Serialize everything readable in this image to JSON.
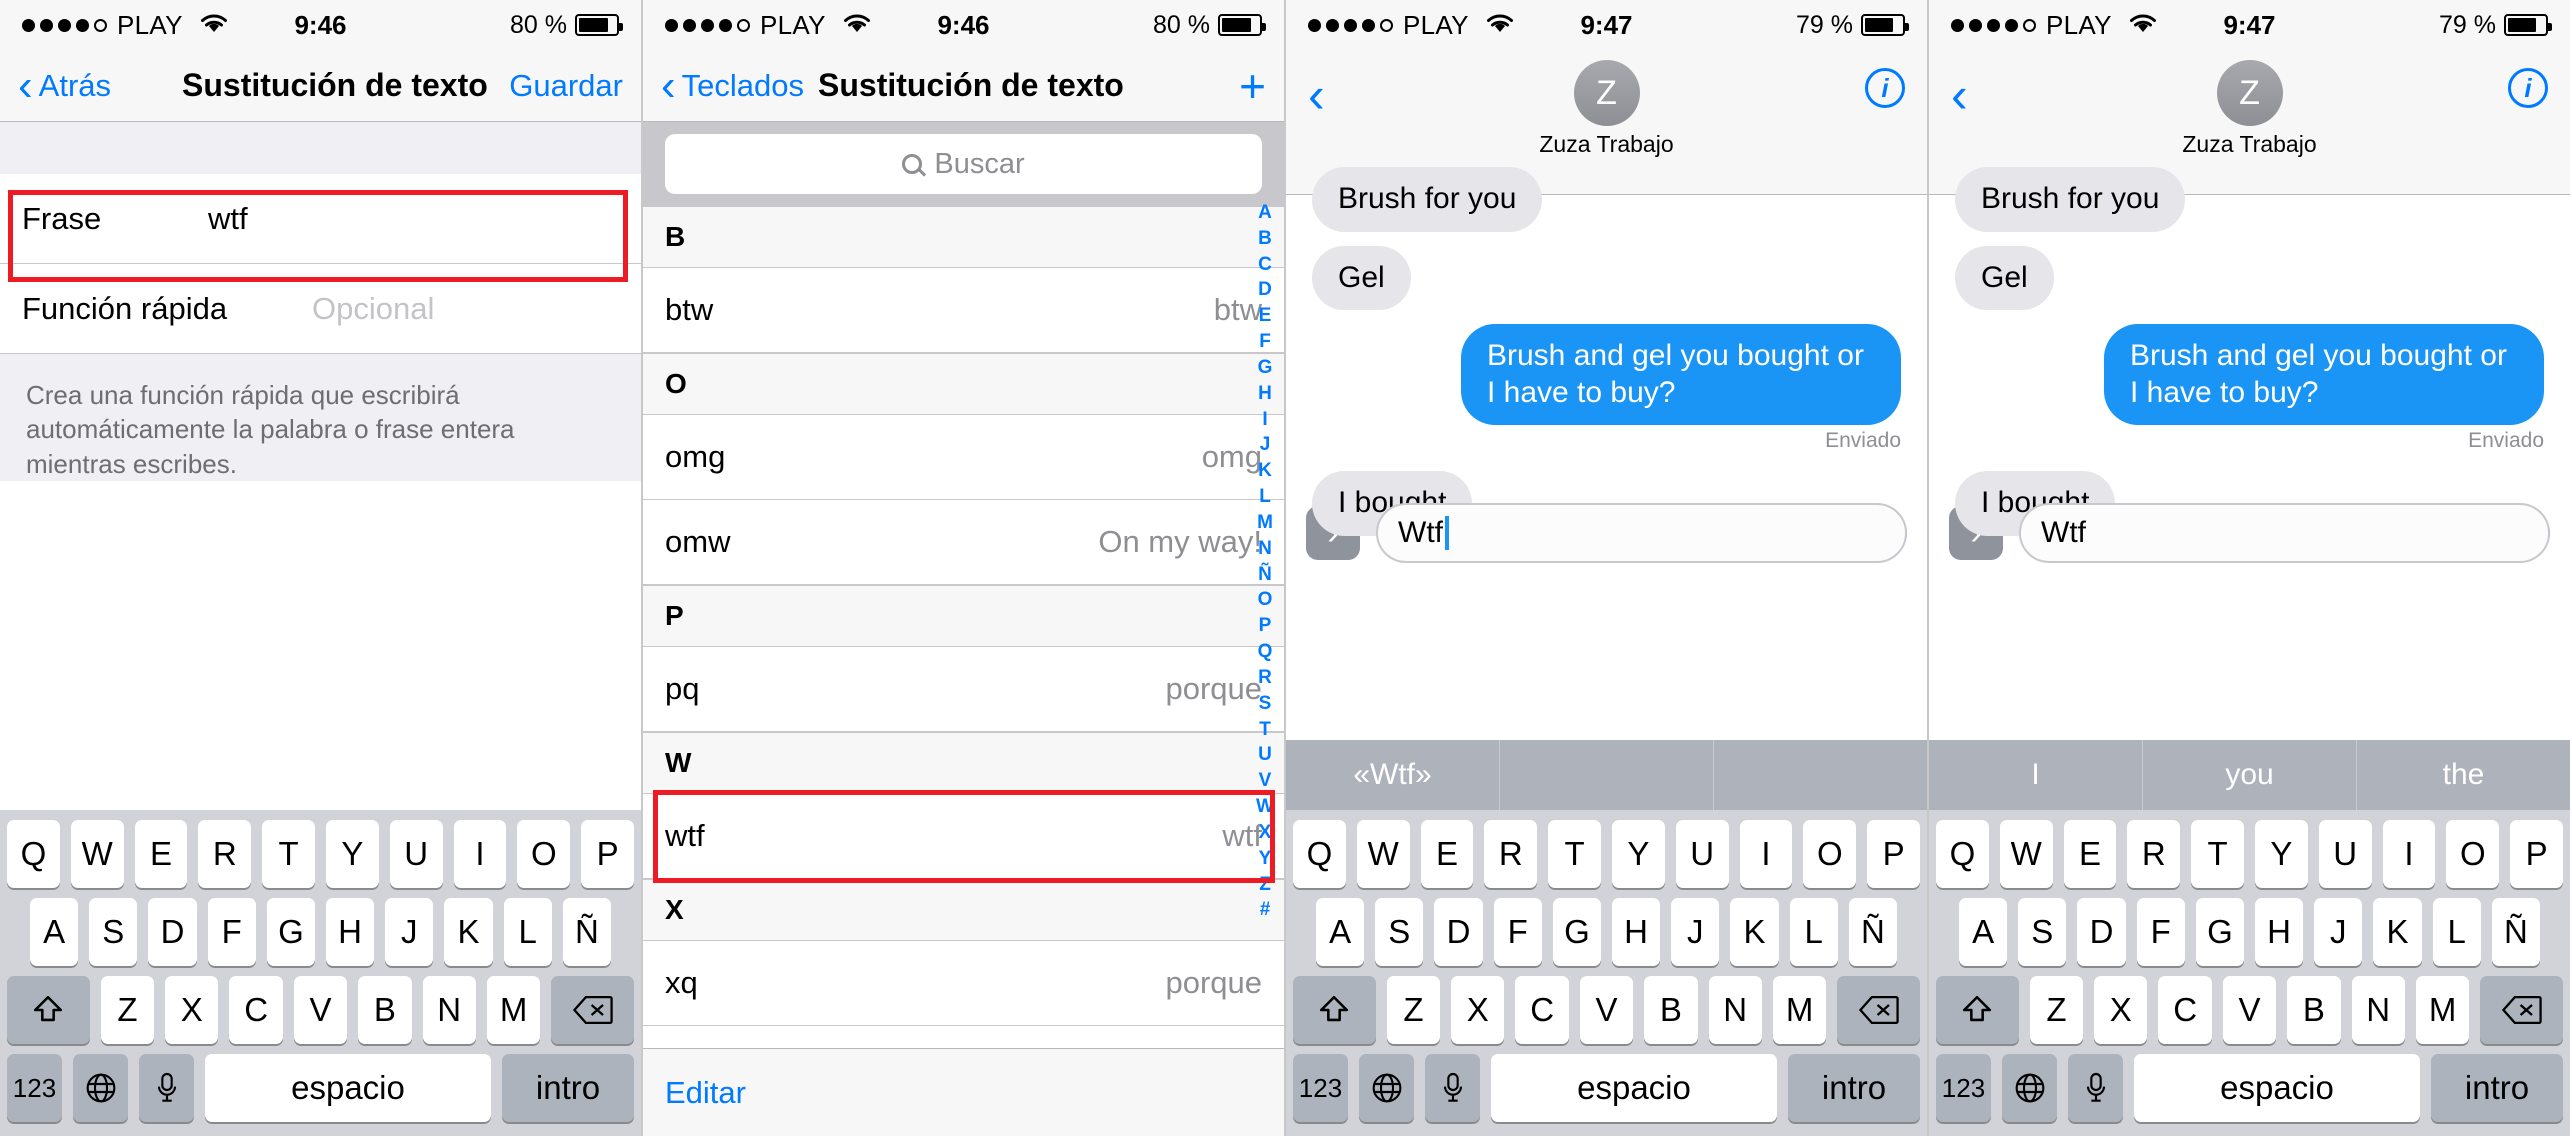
{
  "panels": [
    {
      "status": {
        "carrier": "PLAY",
        "signal_dots": 5,
        "signal_filled": 4,
        "time": "9:46",
        "battery": "80 %",
        "battery_level": 80
      },
      "nav": {
        "back_label": "Atrás",
        "title": "Sustitución de texto",
        "action_label": "Guardar"
      },
      "form": {
        "phrase_label": "Frase",
        "phrase_value": "wtf",
        "shortcut_label": "Función rápida",
        "shortcut_placeholder": "Opcional",
        "hint": "Crea una función rápida que escribirá automáticamente la palabra o frase entera mientras escribes."
      },
      "keyboard": {
        "row1": [
          "Q",
          "W",
          "E",
          "R",
          "T",
          "Y",
          "U",
          "I",
          "O",
          "P"
        ],
        "row2": [
          "A",
          "S",
          "D",
          "F",
          "G",
          "H",
          "J",
          "K",
          "L",
          "Ñ"
        ],
        "row3": [
          "Z",
          "X",
          "C",
          "V",
          "B",
          "N",
          "M"
        ],
        "shift_icon": "shift-icon",
        "delete_icon": "delete-icon",
        "numbers_label": "123",
        "globe_icon": "globe-icon",
        "mic_icon": "microphone-icon",
        "space_label": "espacio",
        "return_label": "intro"
      }
    },
    {
      "status": {
        "carrier": "PLAY",
        "signal_dots": 5,
        "signal_filled": 4,
        "time": "9:46",
        "battery": "80 %",
        "battery_level": 80
      },
      "nav": {
        "back_label": "Teclados",
        "title": "Sustitución de texto",
        "action_icon": "plus-icon"
      },
      "search": {
        "placeholder": "Buscar",
        "icon": "search-icon"
      },
      "sections": [
        {
          "header": "B",
          "rows": [
            {
              "phrase": "btw",
              "shortcut": "btw"
            }
          ]
        },
        {
          "header": "O",
          "rows": [
            {
              "phrase": "omg",
              "shortcut": "omg"
            },
            {
              "phrase": "omw",
              "shortcut": "On my way!"
            }
          ]
        },
        {
          "header": "P",
          "rows": [
            {
              "phrase": "pq",
              "shortcut": "porque"
            }
          ]
        },
        {
          "header": "W",
          "rows": [
            {
              "phrase": "wtf",
              "shortcut": "wtf"
            }
          ]
        },
        {
          "header": "X",
          "rows": [
            {
              "phrase": "xq",
              "shortcut": "porque"
            }
          ]
        }
      ],
      "index": [
        "A",
        "B",
        "C",
        "D",
        "E",
        "F",
        "G",
        "H",
        "I",
        "J",
        "K",
        "L",
        "M",
        "N",
        "Ñ",
        "O",
        "P",
        "Q",
        "R",
        "S",
        "T",
        "U",
        "V",
        "W",
        "X",
        "Y",
        "Z",
        "#"
      ],
      "footer": {
        "edit_label": "Editar"
      }
    },
    {
      "status": {
        "carrier": "PLAY",
        "signal_dots": 5,
        "signal_filled": 4,
        "time": "9:47",
        "battery": "79 %",
        "battery_level": 79
      },
      "nav": {
        "back_icon": "back-chevron-icon",
        "avatar_initial": "Z",
        "contact_name": "Zuza Trabajo",
        "info_icon": "info-icon"
      },
      "messages": [
        {
          "side": "in",
          "text": "Brush for you"
        },
        {
          "side": "in",
          "text": "Gel"
        },
        {
          "side": "out",
          "text": "Brush and gel you bought or I have to buy?",
          "status": "Enviado"
        },
        {
          "side": "in",
          "text": "I bought"
        }
      ],
      "input": {
        "value": "Wtf",
        "plus_icon": "expand-chevron-icon",
        "send_icon": "send-arrow-icon"
      },
      "predictions": [
        "«Wtf»",
        "",
        ""
      ],
      "keyboard": {
        "row1": [
          "Q",
          "W",
          "E",
          "R",
          "T",
          "Y",
          "U",
          "I",
          "O",
          "P"
        ],
        "row2": [
          "A",
          "S",
          "D",
          "F",
          "G",
          "H",
          "J",
          "K",
          "L",
          "Ñ"
        ],
        "row3": [
          "Z",
          "X",
          "C",
          "V",
          "B",
          "N",
          "M"
        ],
        "shift_icon": "shift-icon",
        "delete_icon": "delete-icon",
        "numbers_label": "123",
        "globe_icon": "globe-icon",
        "mic_icon": "microphone-icon",
        "space_label": "espacio",
        "return_label": "intro"
      }
    },
    {
      "status": {
        "carrier": "PLAY",
        "signal_dots": 5,
        "signal_filled": 4,
        "time": "9:47",
        "battery": "79 %",
        "battery_level": 79
      },
      "nav": {
        "back_icon": "back-chevron-icon",
        "avatar_initial": "Z",
        "contact_name": "Zuza Trabajo",
        "info_icon": "info-icon"
      },
      "messages": [
        {
          "side": "in",
          "text": "Brush for you"
        },
        {
          "side": "in",
          "text": "Gel"
        },
        {
          "side": "out",
          "text": "Brush and gel you bought or I have to buy?",
          "status": "Enviado"
        },
        {
          "side": "in",
          "text": "I bought"
        }
      ],
      "input": {
        "value": "Wtf",
        "plus_icon": "expand-chevron-icon",
        "send_icon": "send-arrow-icon"
      },
      "predictions": [
        "I",
        "you",
        "the"
      ],
      "keyboard": {
        "row1": [
          "Q",
          "W",
          "E",
          "R",
          "T",
          "Y",
          "U",
          "I",
          "O",
          "P"
        ],
        "row2": [
          "A",
          "S",
          "D",
          "F",
          "G",
          "H",
          "J",
          "K",
          "L",
          "Ñ"
        ],
        "row3": [
          "Z",
          "X",
          "C",
          "V",
          "B",
          "N",
          "M"
        ],
        "shift_icon": "shift-icon",
        "delete_icon": "delete-icon",
        "numbers_label": "123",
        "globe_icon": "globe-icon",
        "mic_icon": "microphone-icon",
        "space_label": "espacio",
        "return_label": "intro"
      }
    }
  ],
  "annotations": {
    "highlight_color": "#ed1c24"
  }
}
